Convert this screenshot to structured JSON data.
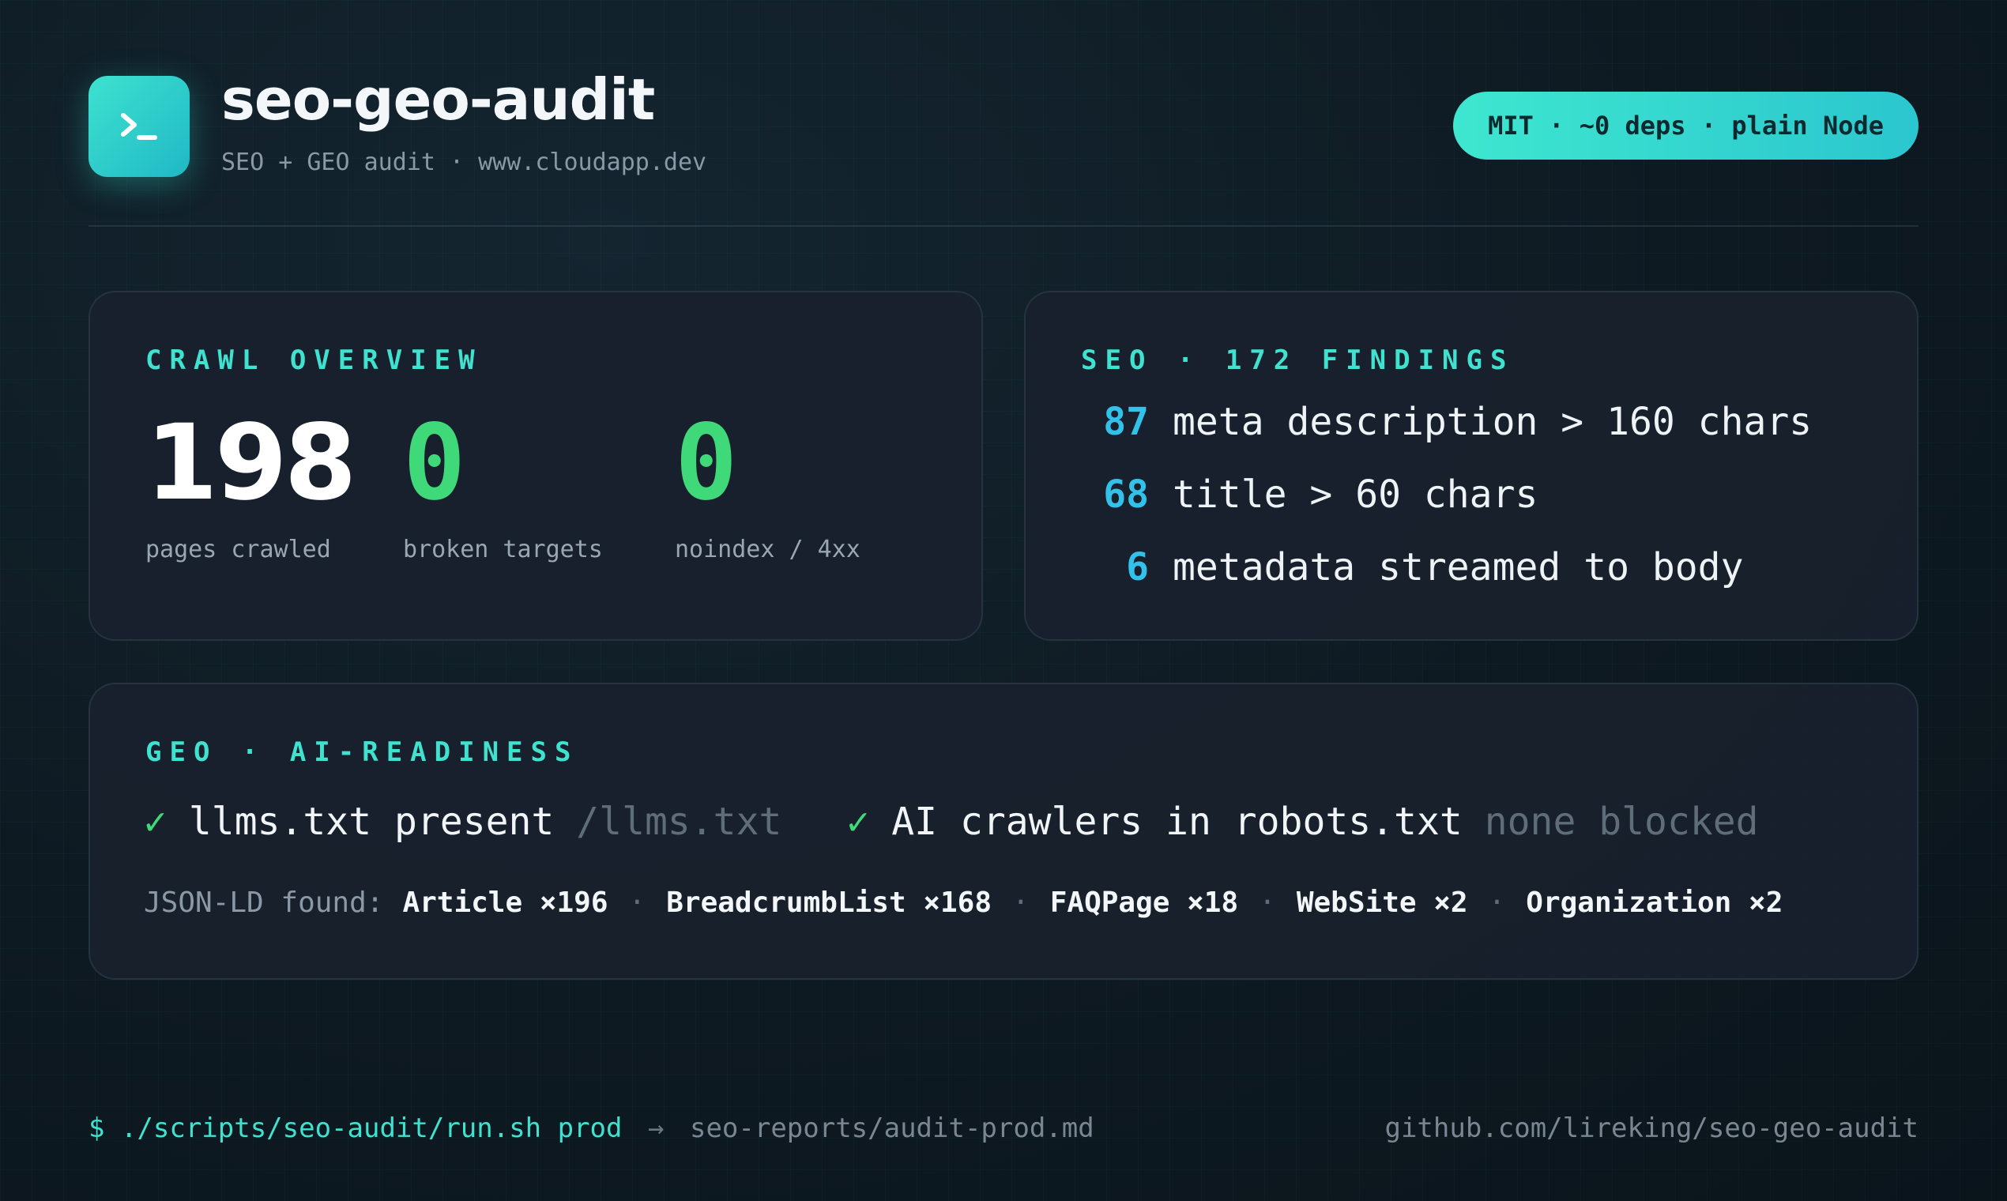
{
  "header": {
    "logo_icon": "terminal-prompt-icon",
    "title": "seo-geo-audit",
    "subtitle": "SEO + GEO audit · www.cloudapp.dev",
    "badge": "MIT · ~0 deps · plain Node"
  },
  "colors": {
    "accent": "#3ee2cf",
    "success": "#3fd97a",
    "count": "#33c1ea"
  },
  "crawl": {
    "heading": "CRAWL OVERVIEW",
    "stats": [
      {
        "value": "198",
        "label": "pages crawled"
      },
      {
        "value": "0",
        "label": "broken targets"
      },
      {
        "value": "0",
        "label": "noindex / 4xx"
      }
    ]
  },
  "seo": {
    "heading": "SEO · 172 FINDINGS",
    "findings": [
      {
        "count": "87",
        "text": "meta description > 160 chars"
      },
      {
        "count": "68",
        "text": "title > 60 chars"
      },
      {
        "count": "6",
        "text": "metadata streamed to body"
      }
    ]
  },
  "geo": {
    "heading": "GEO · AI-READINESS",
    "checks": [
      {
        "mark": "✓",
        "text": "llms.txt present",
        "detail": "/llms.txt"
      },
      {
        "mark": "✓",
        "text": "AI crawlers in robots.txt",
        "detail": "none blocked"
      }
    ],
    "jsonld_label": "JSON-LD found:",
    "jsonld_items": [
      "Article ×196",
      "BreadcrumbList ×168",
      "FAQPage ×18",
      "WebSite ×2",
      "Organization ×2"
    ],
    "separator": "·"
  },
  "footer": {
    "command": "$ ./scripts/seo-audit/run.sh prod",
    "arrow": "→",
    "output": "seo-reports/audit-prod.md",
    "repo": "github.com/lireking/seo-geo-audit"
  }
}
